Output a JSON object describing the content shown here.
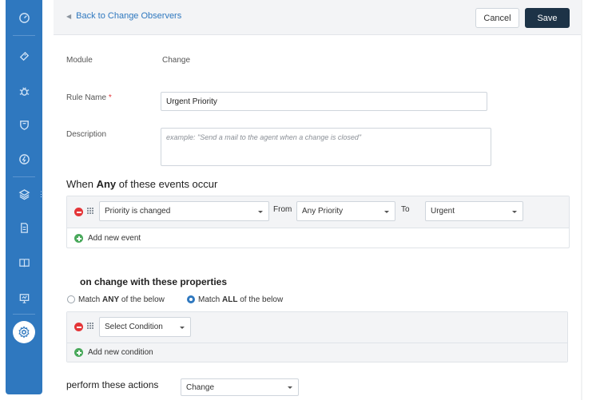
{
  "sidebar": {
    "items": [
      {
        "icon": "dashboard-icon"
      },
      {
        "icon": "ticket-icon"
      },
      {
        "icon": "bug-icon"
      },
      {
        "icon": "shield-icon"
      },
      {
        "icon": "release-icon"
      },
      {
        "icon": "layers-icon"
      },
      {
        "icon": "document-icon"
      },
      {
        "icon": "book-icon"
      },
      {
        "icon": "monitor-icon"
      },
      {
        "icon": "settings-icon",
        "active": true
      }
    ],
    "more_glyph": "⋮"
  },
  "header": {
    "back_label": "Back to Change Observers",
    "back_arrow": "◀",
    "cancel_label": "Cancel",
    "save_label": "Save"
  },
  "form": {
    "module_label": "Module",
    "module_value": "Change",
    "rule_name_label": "Rule Name",
    "required_mark": "*",
    "rule_name_value": "Urgent Priority",
    "description_label": "Description",
    "description_placeholder": "example: \"Send a mail to the agent when a change is closed\""
  },
  "events": {
    "title_prefix": "When",
    "title_bold": "Any",
    "title_suffix": "of these events occur",
    "event_select": "Priority is changed",
    "from_label": "From",
    "from_select": "Any Priority",
    "to_label": "To",
    "to_select": "Urgent",
    "add_label": "Add new event"
  },
  "conditions": {
    "title": "on change with these properties",
    "match_any_prefix": "Match",
    "match_any_bold": "ANY",
    "match_any_suffix": "of the below",
    "match_all_prefix": "Match",
    "match_all_bold": "ALL",
    "match_all_suffix": "of the below",
    "selected": "all",
    "condition_select": "Select Condition",
    "add_label": "Add new condition"
  },
  "actions": {
    "title": "perform these actions",
    "action_select": "Change"
  },
  "colors": {
    "sidebar": "#2f78bf",
    "save_button": "#1d3347",
    "link": "#2f78bf",
    "remove": "#e43538",
    "add": "#4aa95c"
  }
}
